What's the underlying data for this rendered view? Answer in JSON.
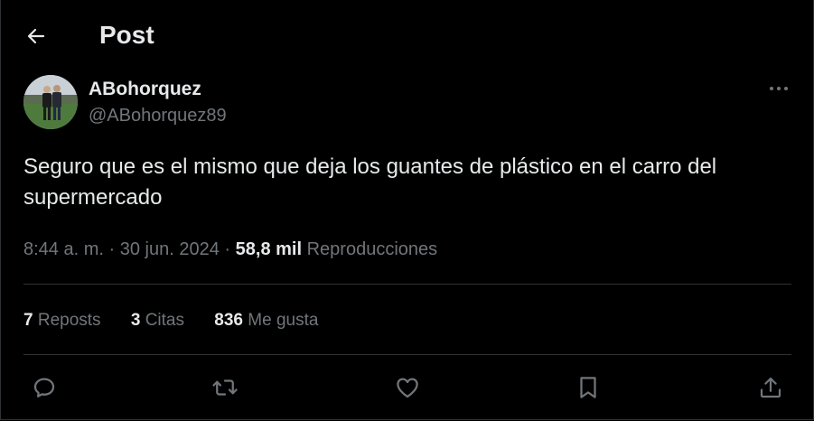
{
  "header": {
    "title": "Post",
    "back_icon": "arrow-left-icon"
  },
  "author": {
    "display_name": "ABohorquez",
    "handle": "@ABohorquez89",
    "avatar_icon": "profile-photo"
  },
  "tweet": {
    "text": "Seguro que es el mismo que deja los guantes de plástico en el carro del supermercado"
  },
  "meta": {
    "time": "8:44 a. m.",
    "separator": "·",
    "date": "30 jun. 2024",
    "views_count": "58,8 mil",
    "views_label": "Reproducciones"
  },
  "stats": {
    "reposts_count": "7",
    "reposts_label": "Reposts",
    "quotes_count": "3",
    "quotes_label": "Citas",
    "likes_count": "836",
    "likes_label": "Me gusta"
  },
  "actions": [
    "reply-icon",
    "repost-icon",
    "like-icon",
    "bookmark-icon",
    "share-icon"
  ],
  "colors": {
    "background": "#000000",
    "text_primary": "#e7e9ea",
    "text_secondary": "#71767b",
    "divider": "#2f3336"
  }
}
